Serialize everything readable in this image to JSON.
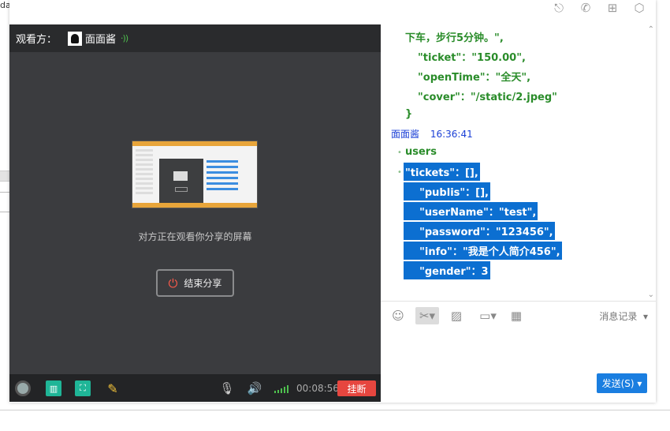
{
  "background": {
    "fragment": "da"
  },
  "window": {
    "top_icons": [
      "screen-share-icon",
      "phone-icon",
      "add-icon",
      "settings-icon"
    ]
  },
  "share": {
    "viewer_label": "观看方：",
    "viewer_name": "面面酱",
    "status_text": "对方正在观看你分享的屏幕",
    "end_button": "结束分享",
    "timer": "00:08:56",
    "hangup": "挂断"
  },
  "chat": {
    "code_lines": [
      "下车，步行5分钟。\",",
      "\"ticket\"：\"150.00\",",
      "\"openTime\"：\"全天\",",
      "\"cover\"：\"/static/2.jpeg\"",
      "}"
    ],
    "sender": "面面酱",
    "time": "16:36:41",
    "plain_item": "users",
    "highlighted": [
      "\"tickets\"：[],",
      "    \"publis\"：[],",
      "    \"userName\"：\"test\",",
      "    \"password\"：\"123456\",",
      "    \"info\"：\"我是个人简介456\",",
      "    \"gender\"：3"
    ]
  },
  "toolbar": {
    "history_label": "消息记录",
    "send_label": "发送(S)"
  },
  "colors": {
    "accent": "#1a7ee0",
    "selection": "#0c6fd1",
    "code_green": "#2a8c2a",
    "hangup_red": "#e6463f",
    "share_bg": "#3b3c3f"
  }
}
